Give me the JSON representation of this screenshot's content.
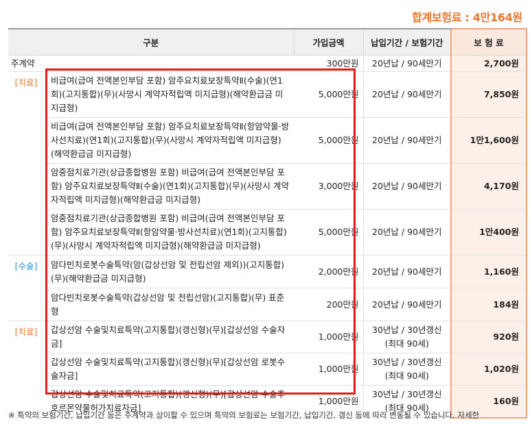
{
  "total": "합계보험료 : 4만164원",
  "headers": {
    "category": "구분",
    "amount": "가입금액",
    "period": "납입기간 / 보험기간",
    "premium": "보 험 료"
  },
  "main_contract": {
    "label": "주계약",
    "amount": "300만원",
    "period": "20년납 / 90세만기",
    "premium": "2,700원"
  },
  "categories": {
    "treat1": "[치료]",
    "surgery": "[수술]",
    "treat2": "[치료]"
  },
  "rows": [
    {
      "name": "비급여(급여 전액본인부담 포함) 암주요치료보장특약Ⅱ(수술)(연1회)(고지통합)(무)(사망시 계약자적립액 미지급형)(해약환급금 미지급형)",
      "amount": "5,000만원",
      "period": "20년납 / 90세만기",
      "premium": "7,850원"
    },
    {
      "name": "비급여(급여 전액본인부담 포함) 암주요치료보장특약Ⅱ(항암약물·방사선치료)(연1회)(고지통합)(무)(사망시 계약자적립액 미지급형)(해약환급금 미지급형)",
      "amount": "5,000만원",
      "period": "20년납 / 90세만기",
      "premium": "1만1,600원"
    },
    {
      "name": "암중점치료기관(상급종합병원 포함) 비급여(급여 전액본인부담 포함) 암주요치료보장특약Ⅱ(수술)(연1회)(고지통합)(무)(사망시 계약자적립액 미지급형)(해약환급금 미지급형)",
      "amount": "3,000만원",
      "period": "20년납 / 90세만기",
      "premium": "4,170원"
    },
    {
      "name": "암중점치료기관(상급종합병원 포함) 비급여(급여 전액본인부담 포함) 암주요치료보장특약Ⅱ(항암약물·방사선치료)(연1회)(고지통합)(무)(사망시 계약자적립액 미지급형)(해약환급금 미지급형)",
      "amount": "5,000만원",
      "period": "20년납 / 90세만기",
      "premium": "1만400원"
    },
    {
      "name": "암다빈치로봇수술특약(암(갑상선암 및 전립선암 제외))(고지통합)(무)(해약환급금 미지급형)",
      "amount": "2,000만원",
      "period": "20년납 / 90세만기",
      "premium": "1,160원"
    },
    {
      "name": "암다빈치로봇수술특약(갑상선암 및 전립선암)(고지통합)(무) 표준형",
      "amount": "200만원",
      "period": "20년납 / 90세만기",
      "premium": "184원"
    },
    {
      "name": "갑상선암 수술및치료특약(고지통합)(갱신형)(무)[갑상선암 수술자금]",
      "amount": "1,000만원",
      "period": "30년납 / 30년갱신",
      "period2": "(최대 90세)",
      "premium": "920원"
    },
    {
      "name": "갑상선암 수술및치료특약(고지통합)(갱신형)(무)[갑상선암 로봇수술자금]",
      "amount": "1,000만원",
      "period": "30년납 / 30년갱신",
      "period2": "(최대 90세)",
      "premium": "1,020원"
    },
    {
      "name": "갑상선암 수술및치료특약(고지통합)(갱신형)(무)[갑상선암 수술후호르몬약물허가치료자금]",
      "amount": "1,000만원",
      "period": "30년납 / 30년갱신",
      "period2": "(최대 90세)",
      "premium": "160원"
    }
  ],
  "note": "※ 특약의 보험기간, 납입기간 등은 주계약과 상이할 수 있으며 특약의 보험료는 보험기간, 납입기간, 갱신 등에 따라 변동될 수 있습니다. 자세한"
}
